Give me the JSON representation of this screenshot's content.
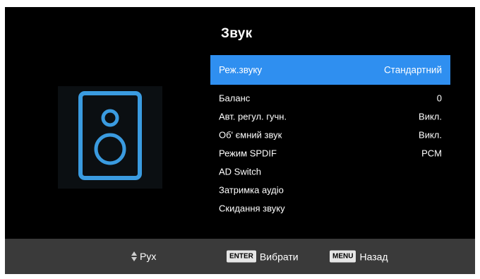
{
  "screen": {
    "title": "Звук"
  },
  "icon": {
    "name": "speaker-icon",
    "color": "#3a9be0"
  },
  "menu": {
    "items": [
      {
        "label": "Реж.звуку",
        "value": "Стандартний",
        "selected": true
      },
      {
        "label": "Баланс",
        "value": "0"
      },
      {
        "label": "Авт. регул. гучн.",
        "value": "Викл."
      },
      {
        "label": "Об' ємний звук",
        "value": "Викл."
      },
      {
        "label": "Режим  SPDIF",
        "value": "PCM"
      },
      {
        "label": "AD Switch",
        "value": ""
      },
      {
        "label": "Затримка аудіо",
        "value": ""
      },
      {
        "label": "Скидання звуку",
        "value": ""
      }
    ]
  },
  "footer": {
    "move_label": "Рух",
    "enter_key": "ENTER",
    "enter_label": "Вибрати",
    "menu_key": "MENU",
    "menu_label": "Назад"
  },
  "colors": {
    "highlight": "#2f8ff0",
    "footer_bg": "#3a3a3a"
  }
}
